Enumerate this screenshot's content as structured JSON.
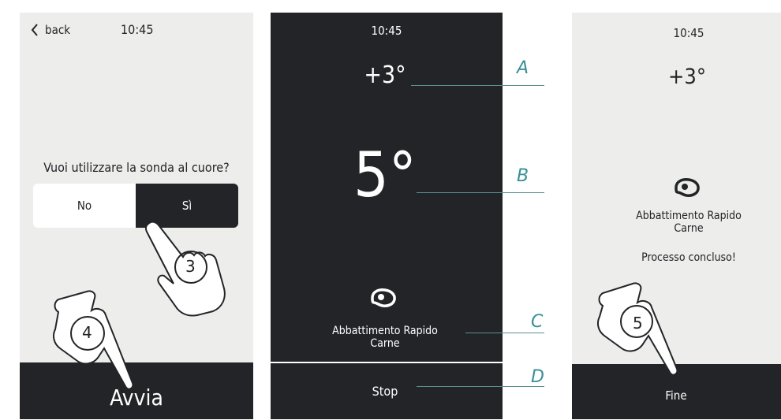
{
  "screen1": {
    "back_label": "back",
    "time": "10:45",
    "question": "Vuoi utilizzare la sonda al cuore?",
    "option_no": "No",
    "option_yes": "Sì",
    "start_label": "Avvia"
  },
  "screen2": {
    "time": "10:45",
    "set_temp": "+3°",
    "probe_temp": "5°",
    "program_line1": "Abbattimento Rapido",
    "program_line2": "Carne",
    "stop_label": "Stop"
  },
  "screen3": {
    "time": "10:45",
    "set_temp": "+3°",
    "program_line1": "Abbattimento Rapido",
    "program_line2": "Carne",
    "status": "Processo concluso!",
    "end_label": "Fine"
  },
  "callouts": {
    "a": "A",
    "b": "B",
    "c": "C",
    "d": "D"
  },
  "steps": {
    "step3": "3",
    "step4": "4",
    "step5": "5"
  },
  "icons": [
    "chevron-left-icon",
    "meat-icon",
    "hand-pointer-icon"
  ],
  "colors": {
    "light_bg": "#ededeb",
    "dark_bg": "#222427",
    "callout_accent": "#3a8f96"
  }
}
